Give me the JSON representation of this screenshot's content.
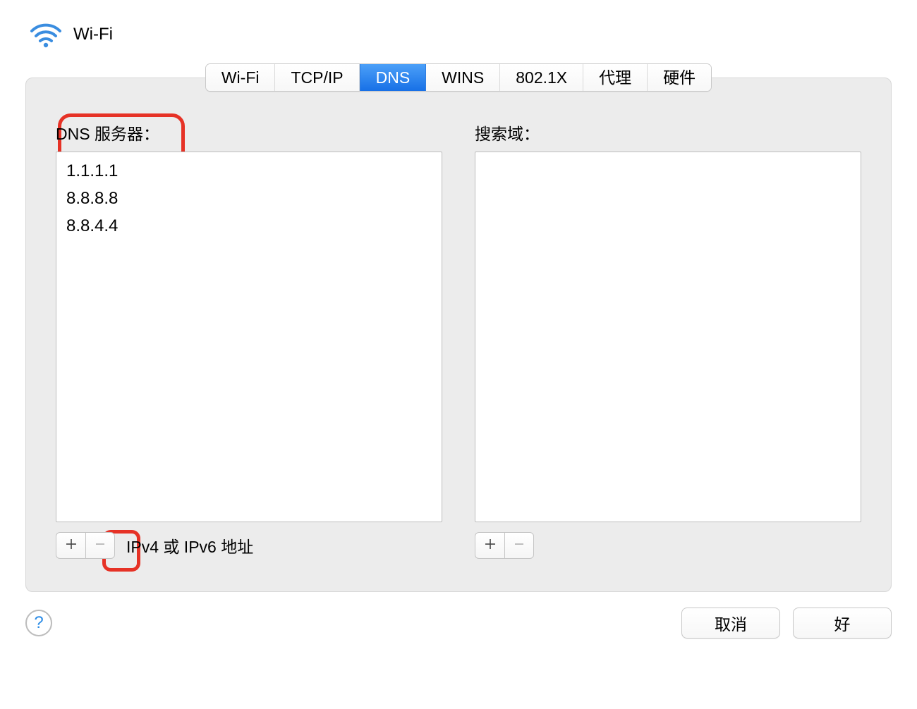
{
  "header": {
    "title": "Wi-Fi"
  },
  "tabs": {
    "wifi": "Wi-Fi",
    "tcpip": "TCP/IP",
    "dns": "DNS",
    "wins": "WINS",
    "dot1x": "802.1X",
    "proxy": "代理",
    "hardware": "硬件"
  },
  "dns": {
    "label": "DNS 服务器：",
    "servers": [
      "1.1.1.1",
      "8.8.8.8",
      "8.8.4.4"
    ],
    "hint": "IPv4 或 IPv6 地址"
  },
  "search": {
    "label": "搜索域："
  },
  "footer": {
    "help": "?",
    "cancel": "取消",
    "ok": "好"
  }
}
